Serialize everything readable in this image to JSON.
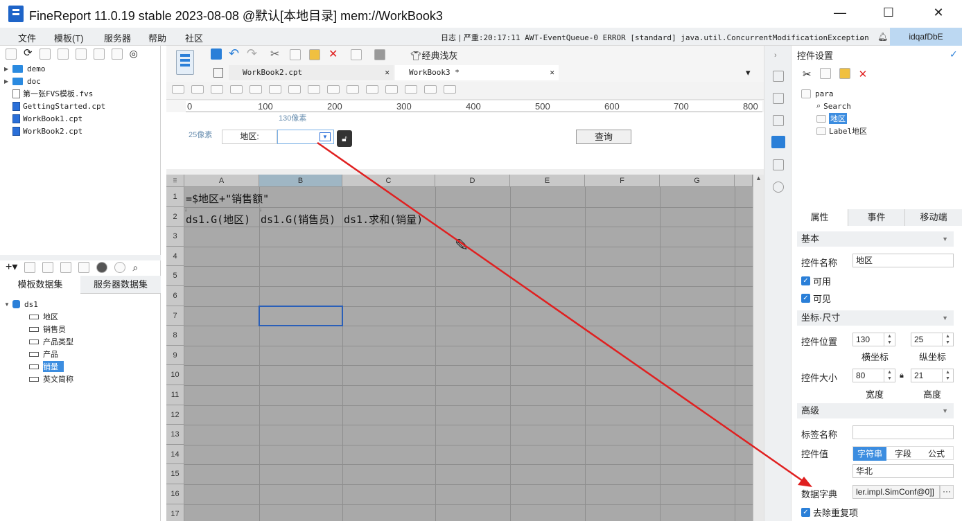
{
  "window": {
    "title": "FineReport 11.0.19 stable 2023-08-08 @默认[本地目录]    mem://WorkBook3"
  },
  "menu": [
    "文件",
    "模板(T)",
    "服务器",
    "帮助",
    "社区"
  ],
  "log": {
    "label": "日志",
    "message": "严重:20:17:11 AWT-EventQueue-0 ERROR [standard] java.util.ConcurrentModificationException"
  },
  "user": "idqafDbE",
  "file_tree": [
    {
      "name": "demo",
      "type": "folder"
    },
    {
      "name": "doc",
      "type": "folder"
    },
    {
      "name": "第一张FVS模板.fvs",
      "type": "fvs"
    },
    {
      "name": "GettingStarted.cpt",
      "type": "cpt"
    },
    {
      "name": "WorkBook1.cpt",
      "type": "cpt"
    },
    {
      "name": "WorkBook2.cpt",
      "type": "cpt"
    }
  ],
  "dataset_tabs": [
    "模板数据集",
    "服务器数据集"
  ],
  "dataset": {
    "name": "ds1",
    "fields": [
      "地区",
      "销售员",
      "产品类型",
      "产品",
      "销量",
      "英文简称"
    ],
    "selected": "销量"
  },
  "toolbar": {
    "classic_gray": "经典浅灰"
  },
  "doc_tabs": [
    "WorkBook2.cpt",
    "WorkBook3 *"
  ],
  "ruler_labels": [
    "0",
    "100",
    "200",
    "300",
    "400",
    "500",
    "600",
    "700",
    "800"
  ],
  "param": {
    "x_hint": "130像素",
    "y_hint": "25像素",
    "label": "地区:",
    "query_button": "查询"
  },
  "sheet": {
    "columns": [
      "A",
      "B",
      "C",
      "D",
      "E",
      "F",
      "G"
    ],
    "rows": [
      "1",
      "2",
      "3",
      "4",
      "5",
      "6",
      "7",
      "8",
      "9",
      "10",
      "11",
      "12",
      "13",
      "14",
      "15",
      "16",
      "17"
    ],
    "cells": {
      "a1": "=$地区+\"销售额\"",
      "a2": "ds1.G(地区)",
      "b2": "ds1.G(销售员)",
      "c2": "ds1.求和(销量)"
    }
  },
  "right": {
    "title": "控件设置",
    "tree": {
      "root": "para",
      "items": [
        "Search",
        "地区",
        "Label地区"
      ],
      "selected": "地区"
    },
    "prop_tabs": [
      "属性",
      "事件",
      "移动端"
    ],
    "basic": {
      "header": "基本",
      "name_label": "控件名称",
      "name_value": "地区",
      "enabled": "可用",
      "visible": "可见"
    },
    "coords": {
      "header": "坐标·尺寸",
      "pos_label": "控件位置",
      "x": "130",
      "y": "25",
      "x_label": "横坐标",
      "y_label": "纵坐标",
      "size_label": "控件大小",
      "w": "80",
      "h": "21",
      "w_label": "宽度",
      "h_label": "高度"
    },
    "advanced": {
      "header": "高级",
      "tag_label": "标签名称",
      "tag_value": "",
      "value_label": "控件值",
      "value_modes": [
        "字符串",
        "字段",
        "公式"
      ],
      "value_mode_selected": "字符串",
      "value": "华北",
      "dict_label": "数据字典",
      "dict_value": "ler.impl.SimConf@0]]",
      "dedupe": "去除重复项"
    }
  },
  "annotation": {
    "color": "#e02020"
  }
}
